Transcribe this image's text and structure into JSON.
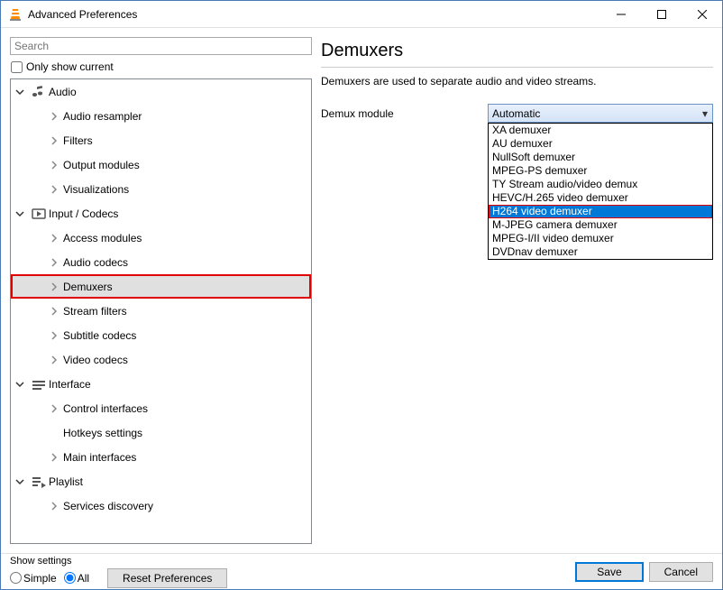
{
  "window": {
    "title": "Advanced Preferences"
  },
  "left": {
    "search_placeholder": "Search",
    "only_show_current": "Only show current",
    "tree": {
      "audio": {
        "label": "Audio",
        "items": [
          "Audio resampler",
          "Filters",
          "Output modules",
          "Visualizations"
        ]
      },
      "input_codecs": {
        "label": "Input / Codecs",
        "items": [
          "Access modules",
          "Audio codecs",
          "Demuxers",
          "Stream filters",
          "Subtitle codecs",
          "Video codecs"
        ],
        "selected_index": 2
      },
      "interface": {
        "label": "Interface",
        "items": [
          "Control interfaces",
          "Hotkeys settings",
          "Main interfaces"
        ]
      },
      "playlist": {
        "label": "Playlist",
        "items": [
          "Services discovery"
        ]
      }
    }
  },
  "right": {
    "title": "Demuxers",
    "description": "Demuxers are used to separate audio and video streams.",
    "form": {
      "demux_label": "Demux module",
      "demux_value": "Automatic",
      "options": [
        "XA demuxer",
        "AU demuxer",
        "NullSoft demuxer",
        "MPEG-PS demuxer",
        "TY Stream audio/video demux",
        "HEVC/H.265 video demuxer",
        "H264 video demuxer",
        "M-JPEG camera demuxer",
        "MPEG-I/II video demuxer",
        "DVDnav demuxer"
      ],
      "highlighted_index": 6
    }
  },
  "bottom": {
    "show_settings_label": "Show settings",
    "simple": "Simple",
    "all": "All",
    "reset": "Reset Preferences",
    "save": "Save",
    "cancel": "Cancel"
  }
}
